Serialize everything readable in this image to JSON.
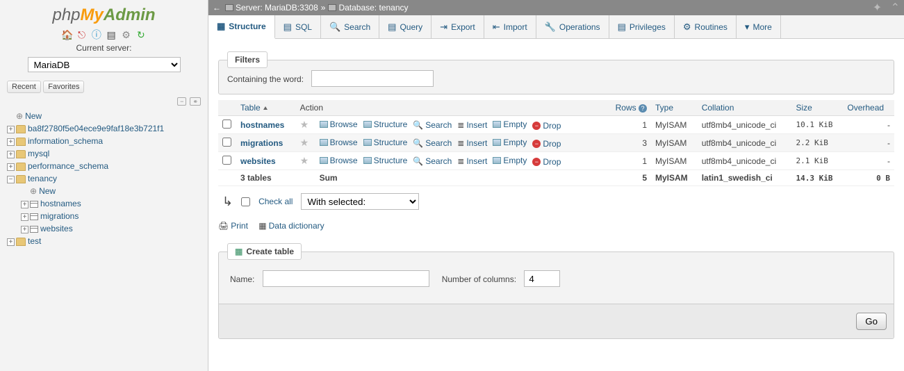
{
  "logo": {
    "php": "php",
    "my": "My",
    "admin": "Admin"
  },
  "sidebar": {
    "current_server_label": "Current server:",
    "server_value": "MariaDB",
    "recent": "Recent",
    "favorites": "Favorites",
    "tree": {
      "new": "New",
      "databases": [
        {
          "name": "ba8f2780f5e04ece9e9faf18e3b721f1"
        },
        {
          "name": "information_schema"
        },
        {
          "name": "mysql"
        },
        {
          "name": "performance_schema"
        },
        {
          "name": "tenancy",
          "expanded": true,
          "children": [
            {
              "name": "New",
              "isNew": true
            },
            {
              "name": "hostnames"
            },
            {
              "name": "migrations"
            },
            {
              "name": "websites"
            }
          ]
        },
        {
          "name": "test"
        }
      ]
    }
  },
  "breadcrumb": {
    "server_label": "Server:",
    "server": "MariaDB:3308",
    "db_label": "Database:",
    "db": "tenancy"
  },
  "tabs": [
    {
      "label": "Structure",
      "icon": "▦",
      "active": true
    },
    {
      "label": "SQL",
      "icon": "▤"
    },
    {
      "label": "Search",
      "icon": "🔍"
    },
    {
      "label": "Query",
      "icon": "▤"
    },
    {
      "label": "Export",
      "icon": "⇥"
    },
    {
      "label": "Import",
      "icon": "⇤"
    },
    {
      "label": "Operations",
      "icon": "🔧"
    },
    {
      "label": "Privileges",
      "icon": "▤"
    },
    {
      "label": "Routines",
      "icon": "⚙"
    },
    {
      "label": "More",
      "icon": "▾"
    }
  ],
  "filters": {
    "legend": "Filters",
    "label": "Containing the word:",
    "value": ""
  },
  "table_headers": {
    "table": "Table",
    "action": "Action",
    "rows": "Rows",
    "type": "Type",
    "collation": "Collation",
    "size": "Size",
    "overhead": "Overhead"
  },
  "actions": {
    "browse": "Browse",
    "structure": "Structure",
    "search": "Search",
    "insert": "Insert",
    "empty": "Empty",
    "drop": "Drop"
  },
  "rows": [
    {
      "name": "hostnames",
      "rows": "1",
      "type": "MyISAM",
      "collation": "utf8mb4_unicode_ci",
      "size": "10.1 KiB",
      "overhead": "-"
    },
    {
      "name": "migrations",
      "rows": "3",
      "type": "MyISAM",
      "collation": "utf8mb4_unicode_ci",
      "size": "2.2 KiB",
      "overhead": "-"
    },
    {
      "name": "websites",
      "rows": "1",
      "type": "MyISAM",
      "collation": "utf8mb4_unicode_ci",
      "size": "2.1 KiB",
      "overhead": "-"
    }
  ],
  "sum": {
    "label": "3 tables",
    "action": "Sum",
    "rows": "5",
    "type": "MyISAM",
    "collation": "latin1_swedish_ci",
    "size": "14.3 KiB",
    "overhead": "0 B"
  },
  "checkall": {
    "label": "Check all",
    "with_selected": "With selected:"
  },
  "print": {
    "print": "Print",
    "dict": "Data dictionary"
  },
  "create": {
    "legend": "Create table",
    "name_label": "Name:",
    "name_value": "",
    "cols_label": "Number of columns:",
    "cols_value": "4",
    "go": "Go"
  }
}
